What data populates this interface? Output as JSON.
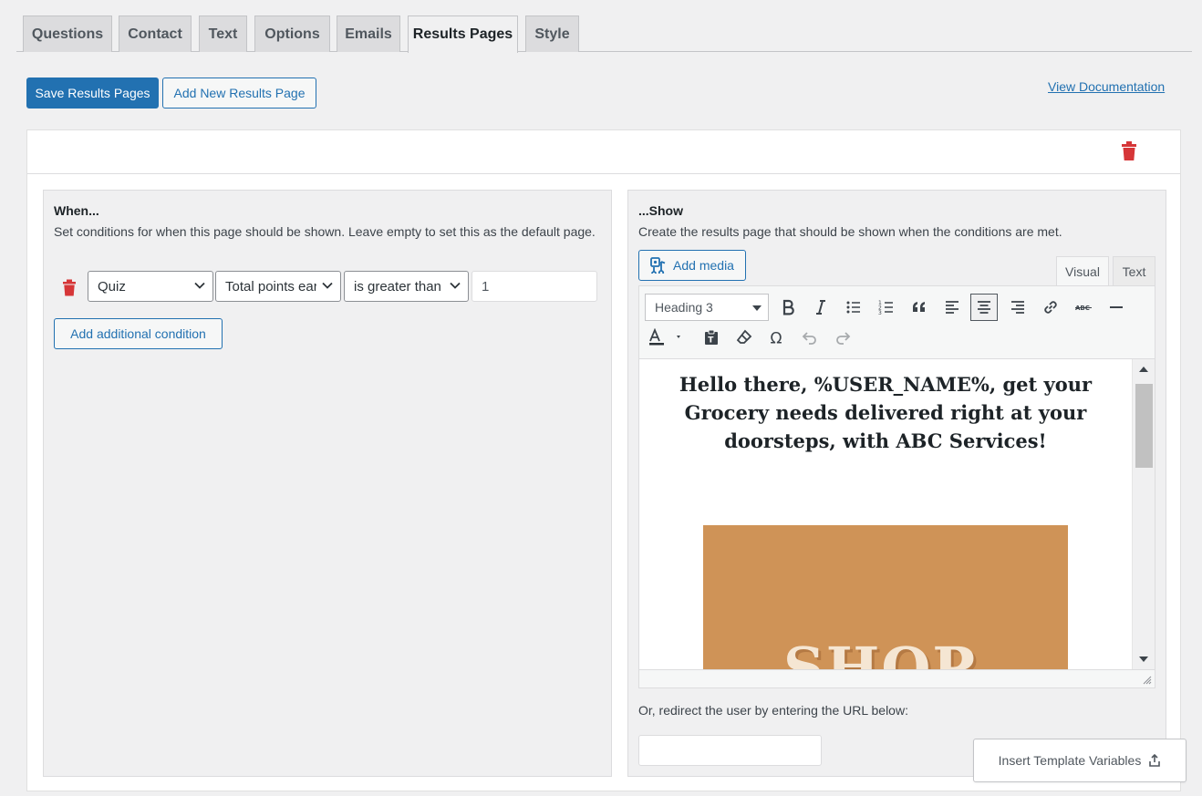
{
  "tabs": [
    {
      "label": "Questions"
    },
    {
      "label": "Contact"
    },
    {
      "label": "Text"
    },
    {
      "label": "Options"
    },
    {
      "label": "Emails"
    },
    {
      "label": "Results Pages"
    },
    {
      "label": "Style"
    }
  ],
  "active_tab": "Results Pages",
  "actions": {
    "save_label": "Save Results Pages",
    "add_label": "Add New Results Page",
    "doc_link": "View Documentation"
  },
  "when_panel": {
    "title": "When...",
    "description": "Set conditions for when this page should be shown. Leave empty to set this as the default page.",
    "condition": {
      "category": "Quiz",
      "criteria": "Total points earned",
      "operator": "is greater than",
      "value": "1"
    },
    "add_condition_label": "Add additional condition"
  },
  "show_panel": {
    "title": "...Show",
    "description": "Create the results page that should be shown when the conditions are met.",
    "add_media_label": "Add media",
    "editor_tabs": {
      "visual": "Visual",
      "text": "Text"
    },
    "format_select": "Heading 3",
    "content_heading": "Hello there, %USER_NAME%, get your Grocery needs delivered right at your doorsteps, with ABC Services!",
    "image_text": "SHOP",
    "redirect_label": "Or, redirect the user by entering the URL below:",
    "redirect_value": ""
  },
  "insert_variables_label": "Insert Template Variables",
  "colors": {
    "primary": "#2271b1",
    "danger": "#d63638",
    "image_bg": "#cf9357"
  },
  "icons": [
    "trash-icon",
    "add-media-icon",
    "bold-icon",
    "italic-icon",
    "bullet-list-icon",
    "numbered-list-icon",
    "blockquote-icon",
    "align-left-icon",
    "align-center-icon",
    "align-right-icon",
    "link-icon",
    "strikethrough-icon",
    "horizontal-rule-icon",
    "text-color-icon",
    "paste-text-icon",
    "clear-formatting-icon",
    "special-character-icon",
    "undo-icon",
    "redo-icon",
    "upload-icon"
  ]
}
